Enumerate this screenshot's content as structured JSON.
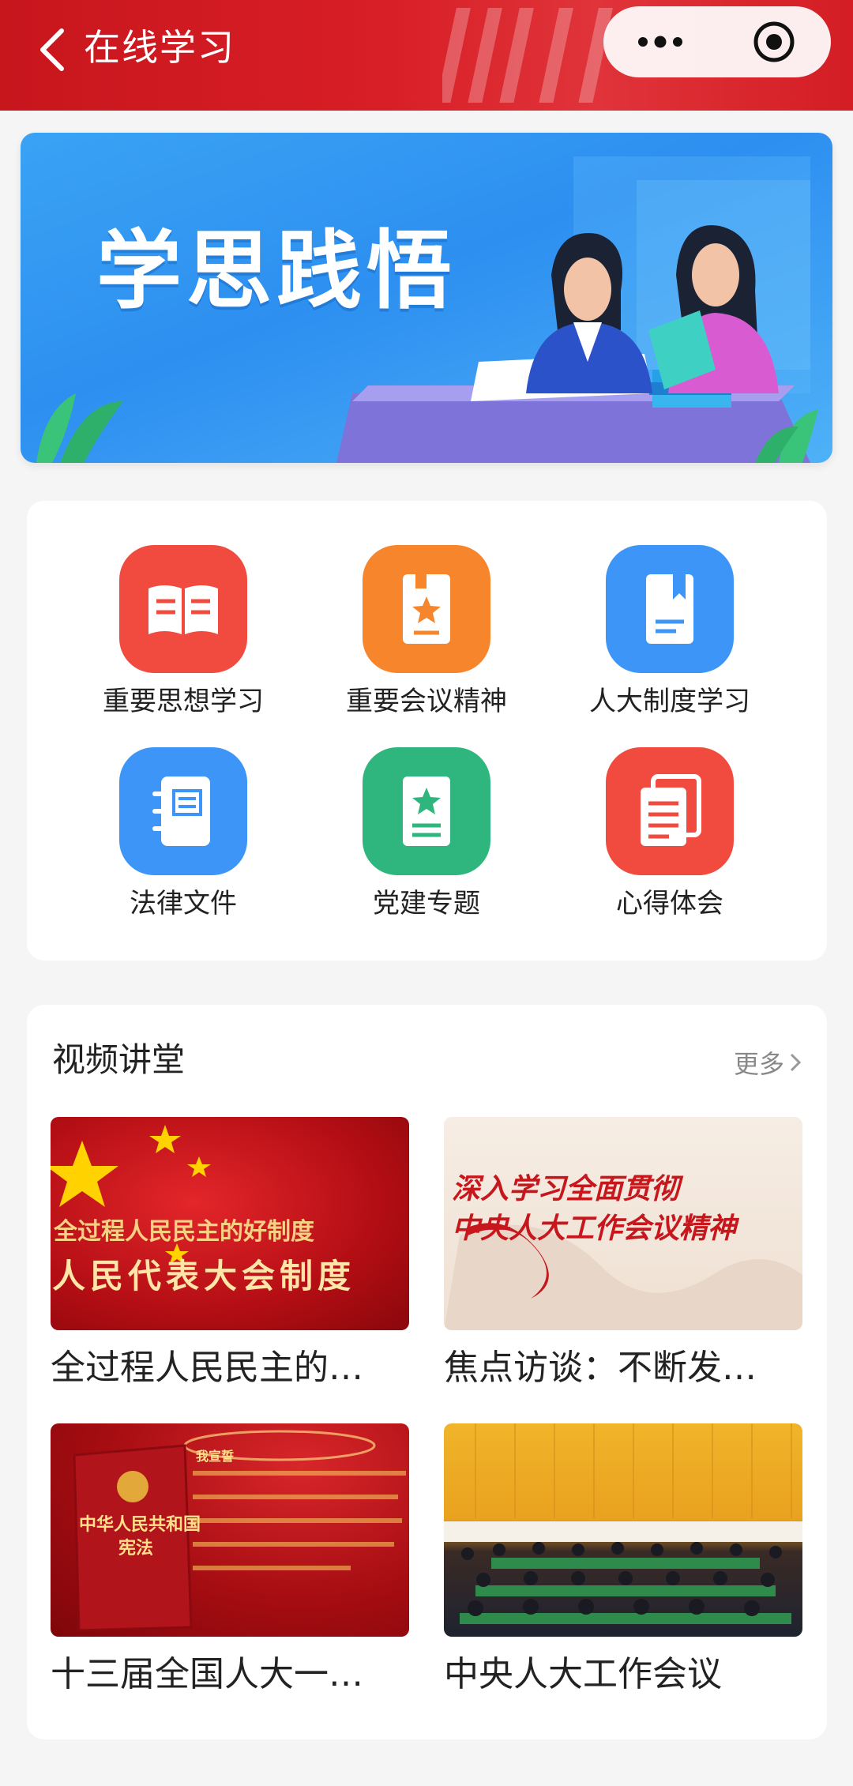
{
  "header": {
    "title": "在线学习"
  },
  "banner": {
    "title": "学思践悟"
  },
  "menu": [
    {
      "label": "重要思想学习",
      "icon": "open-book-icon",
      "color": "#f04b3e"
    },
    {
      "label": "重要会议精神",
      "icon": "star-book-icon",
      "color": "#f6852b"
    },
    {
      "label": "人大制度学习",
      "icon": "bookmark-book-icon",
      "color": "#3d96f7"
    },
    {
      "label": "法律文件",
      "icon": "notebook-icon",
      "color": "#3d96f7"
    },
    {
      "label": "党建专题",
      "icon": "star-document-icon",
      "color": "#2fb67e"
    },
    {
      "label": "心得体会",
      "icon": "documents-icon",
      "color": "#f04b3e"
    }
  ],
  "videos": {
    "title": "视频讲堂",
    "more_label": "更多",
    "items": [
      {
        "caption": "全过程人民民主的…",
        "thumb_line1": "全过程人民民主的好制度",
        "thumb_line2": "人民代表大会制度"
      },
      {
        "caption": "焦点访谈：不断发…",
        "thumb_line1": "深入学习全面贯彻",
        "thumb_line2": "中央人大工作会议精神"
      },
      {
        "caption": "十三届全国人大一…",
        "thumb_line1": "中华人民共和国",
        "thumb_line2": "宪法",
        "thumb_line3": "我宣誓"
      },
      {
        "caption": "中央人大工作会议"
      }
    ]
  },
  "colors": {
    "brand_red": "#d81e26",
    "banner_blue": "#2d8ff0"
  }
}
